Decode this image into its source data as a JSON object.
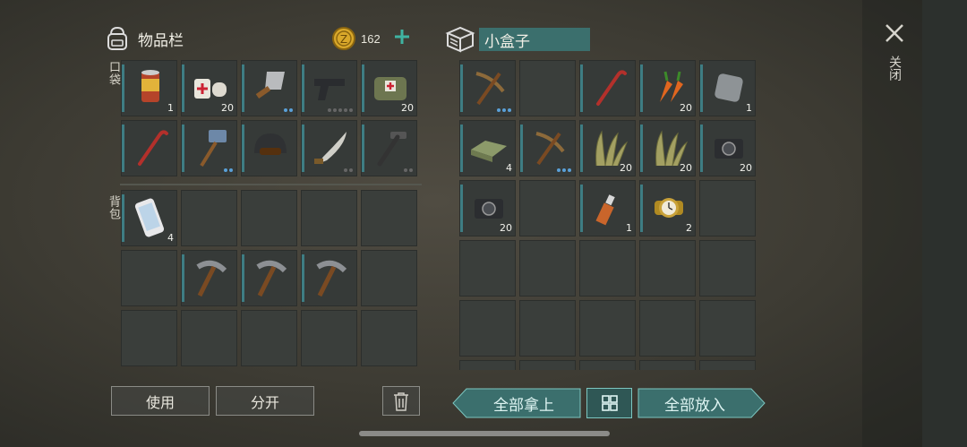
{
  "inventory": {
    "title": "物品栏",
    "coins": "162",
    "pocket_label": "口袋",
    "backpack_label": "背包",
    "pocket": [
      {
        "icon": "canned-food-icon",
        "qty": "1"
      },
      {
        "icon": "bandage-icon",
        "qty": "20"
      },
      {
        "icon": "cleaver-icon",
        "dots": [
          1,
          1
        ]
      },
      {
        "icon": "pistol-icon",
        "dots": [
          0,
          0,
          0,
          0,
          0
        ]
      },
      {
        "icon": "first-aid-bag-icon",
        "qty": "20"
      },
      {
        "icon": "crowbar-icon"
      },
      {
        "icon": "sledgehammer-icon",
        "dots": [
          1,
          1
        ]
      },
      {
        "icon": "helmet-icon"
      },
      {
        "icon": "machete-icon",
        "dots": [
          0,
          0
        ]
      },
      {
        "icon": "hammer-icon",
        "dots": [
          0,
          0
        ]
      }
    ],
    "backpack": [
      {
        "icon": "smartphone-icon",
        "qty": "4"
      },
      {},
      {},
      {},
      {},
      {},
      {
        "icon": "pickaxe-icon"
      },
      {
        "icon": "pickaxe-icon"
      },
      {
        "icon": "pickaxe-icon"
      },
      {},
      {},
      {},
      {},
      {},
      {}
    ]
  },
  "container": {
    "title": "小盒子",
    "items": [
      {
        "icon": "pick-icon",
        "dots": [
          1,
          1,
          1
        ]
      },
      {},
      {
        "icon": "crowbar-icon"
      },
      {
        "icon": "carrot-icon",
        "qty": "20"
      },
      {
        "icon": "metal-plate-icon",
        "qty": "1"
      },
      {
        "icon": "cloth-icon",
        "qty": "4"
      },
      {
        "icon": "pick-icon",
        "dots": [
          1,
          1,
          1
        ]
      },
      {
        "icon": "plant-fiber-icon",
        "qty": "20"
      },
      {
        "icon": "plant-fiber-icon",
        "qty": "20"
      },
      {
        "icon": "camera-icon",
        "qty": "20"
      },
      {
        "icon": "camera-icon",
        "qty": "20"
      },
      {},
      {
        "icon": "usb-drive-icon",
        "qty": "1"
      },
      {
        "icon": "wristwatch-icon",
        "qty": "2"
      },
      {},
      {},
      {},
      {},
      {},
      {},
      {},
      {},
      {},
      {},
      {},
      {},
      {},
      {},
      {},
      {}
    ]
  },
  "buttons": {
    "use": "使用",
    "split": "分开",
    "take_all": "全部拿上",
    "put_all": "全部放入",
    "close": "关闭"
  },
  "colors": {
    "accent": "#3e7d83",
    "teal_button": "#3b6f6d",
    "coin": "#d9a82a"
  }
}
